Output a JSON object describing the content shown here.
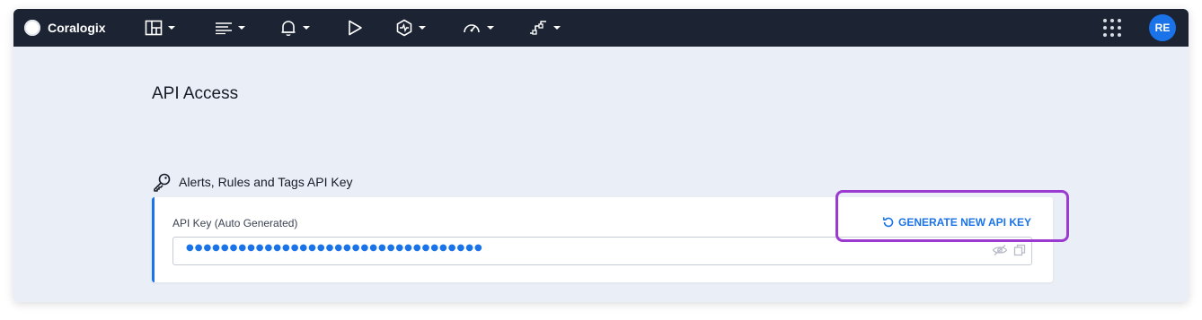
{
  "brand": {
    "name": "Coralogix"
  },
  "nav": [
    {
      "id": "dashboards",
      "icon": "dashboard-icon",
      "has_dropdown": true
    },
    {
      "id": "explore",
      "icon": "explore-list-icon",
      "has_dropdown": true
    },
    {
      "id": "alerts",
      "icon": "bell-icon",
      "has_dropdown": true
    },
    {
      "id": "livetail",
      "icon": "play-icon",
      "has_dropdown": false
    },
    {
      "id": "monitoring",
      "icon": "hexagon-pulse-icon",
      "has_dropdown": true
    },
    {
      "id": "performance",
      "icon": "gauge-icon",
      "has_dropdown": true
    },
    {
      "id": "data-flow",
      "icon": "flow-icon",
      "has_dropdown": true
    }
  ],
  "user": {
    "initials": "RE"
  },
  "page": {
    "title": "API Access"
  },
  "section": {
    "icon": "key-icon",
    "title": "Alerts, Rules and Tags API Key",
    "field_label": "API Key (Auto Generated)",
    "generate_label": "GENERATE NEW API KEY",
    "masked_value": "●●●●●●●●●●●●●●●●●●●●●●●●●●●●●●●●●●"
  },
  "colors": {
    "topbar": "#1c2333",
    "background": "#eaeef7",
    "accent": "#1a73e8",
    "highlight": "#9a3ad0"
  }
}
